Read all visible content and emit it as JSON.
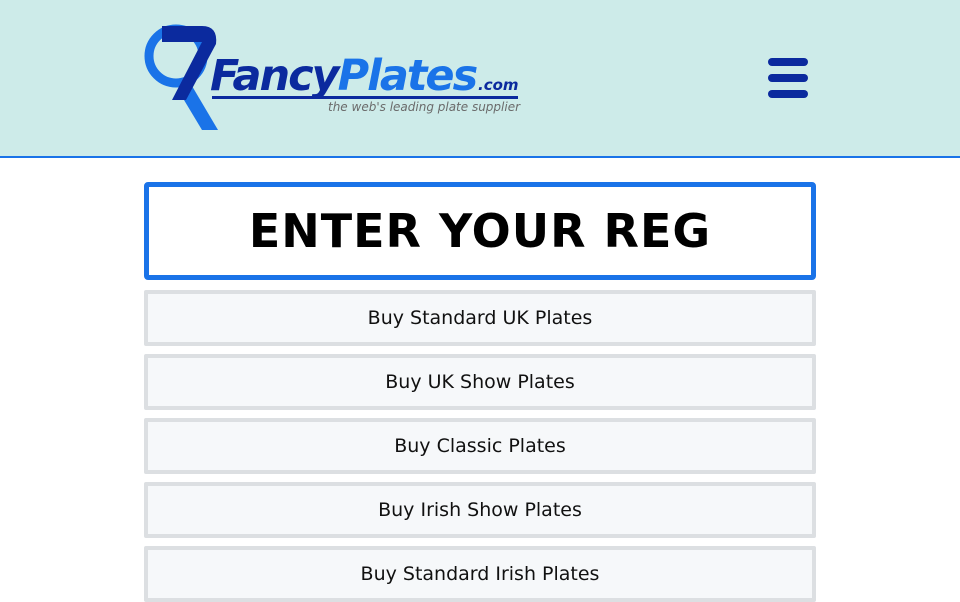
{
  "header": {
    "logo": {
      "brand_part1": "Fancy",
      "brand_part2": "Plates",
      "domain_suffix": ".com",
      "tagline": "the web's leading plate supplier",
      "mark_icon": "magnifier-icon"
    },
    "menu_icon": "hamburger-menu-icon"
  },
  "main": {
    "reg_input": {
      "placeholder": "ENTER YOUR REG",
      "value": ""
    },
    "plate_buttons": [
      {
        "label": "Buy Standard UK Plates"
      },
      {
        "label": "Buy UK Show Plates"
      },
      {
        "label": "Buy Classic Plates"
      },
      {
        "label": "Buy Irish Show Plates"
      },
      {
        "label": "Buy Standard Irish Plates"
      }
    ]
  },
  "colors": {
    "header_bg": "#cdebe9",
    "accent_blue": "#1a73e8",
    "brand_navy": "#0b2a9e",
    "button_bg": "#f6f8fa",
    "button_border": "#dcdfe2"
  }
}
